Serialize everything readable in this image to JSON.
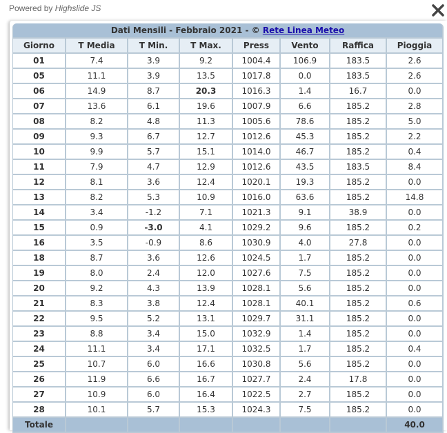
{
  "powered": {
    "prefix": "Powered by",
    "brand": "Highslide JS"
  },
  "close_icon": "close-x-icon",
  "title": {
    "text": "Dati Mensili - Febbraio 2021 - © ",
    "link": "Rete Linea Meteo"
  },
  "columns": [
    "Giorno",
    "T Media",
    "T Min.",
    "T Max.",
    "Press",
    "Vento",
    "Raffica",
    "Pioggia"
  ],
  "colors": {
    "header_bg": "#a9c0d6",
    "day_link": "#1f6aa0",
    "tmax_highlight": "#b40000",
    "tmin_highlight": "#0000aa"
  },
  "rows": [
    [
      "01",
      "7.4",
      "3.9",
      "9.2",
      "1004.4",
      "106.9",
      "183.5",
      "2.6"
    ],
    [
      "05",
      "11.1",
      "3.9",
      "13.5",
      "1017.8",
      "0.0",
      "183.5",
      "2.6"
    ],
    [
      "06",
      "14.9",
      "8.7",
      "20.3",
      "1016.3",
      "1.4",
      "16.7",
      "0.0"
    ],
    [
      "07",
      "13.6",
      "6.1",
      "19.6",
      "1007.9",
      "6.6",
      "185.2",
      "2.8"
    ],
    [
      "08",
      "8.2",
      "4.8",
      "11.3",
      "1005.6",
      "78.6",
      "185.2",
      "5.0"
    ],
    [
      "09",
      "9.3",
      "6.7",
      "12.7",
      "1012.6",
      "45.3",
      "185.2",
      "2.2"
    ],
    [
      "10",
      "9.9",
      "5.7",
      "15.1",
      "1014.0",
      "46.7",
      "185.2",
      "0.4"
    ],
    [
      "11",
      "7.9",
      "4.7",
      "12.9",
      "1012.6",
      "43.5",
      "183.5",
      "8.4"
    ],
    [
      "12",
      "8.1",
      "3.6",
      "12.4",
      "1020.1",
      "19.3",
      "185.2",
      "0.0"
    ],
    [
      "13",
      "8.2",
      "5.3",
      "10.9",
      "1016.0",
      "63.6",
      "185.2",
      "14.8"
    ],
    [
      "14",
      "3.4",
      "-1.2",
      "7.1",
      "1021.3",
      "9.1",
      "38.9",
      "0.0"
    ],
    [
      "15",
      "0.9",
      "-3.0",
      "4.1",
      "1029.2",
      "9.6",
      "185.2",
      "0.2"
    ],
    [
      "16",
      "3.5",
      "-0.9",
      "8.6",
      "1030.9",
      "4.0",
      "27.8",
      "0.0"
    ],
    [
      "18",
      "8.7",
      "3.6",
      "12.6",
      "1024.5",
      "1.7",
      "185.2",
      "0.0"
    ],
    [
      "19",
      "8.0",
      "2.4",
      "12.0",
      "1027.6",
      "7.5",
      "185.2",
      "0.0"
    ],
    [
      "20",
      "9.2",
      "4.3",
      "13.9",
      "1028.1",
      "5.6",
      "185.2",
      "0.0"
    ],
    [
      "21",
      "8.3",
      "3.8",
      "12.4",
      "1028.1",
      "40.1",
      "185.2",
      "0.6"
    ],
    [
      "22",
      "9.5",
      "5.2",
      "13.1",
      "1029.7",
      "31.1",
      "185.2",
      "0.0"
    ],
    [
      "23",
      "8.8",
      "3.4",
      "15.0",
      "1032.9",
      "1.4",
      "185.2",
      "0.0"
    ],
    [
      "24",
      "11.1",
      "3.4",
      "17.1",
      "1032.5",
      "1.7",
      "185.2",
      "0.4"
    ],
    [
      "25",
      "10.7",
      "6.0",
      "16.6",
      "1030.8",
      "5.6",
      "185.2",
      "0.0"
    ],
    [
      "26",
      "11.9",
      "6.6",
      "16.7",
      "1027.7",
      "2.4",
      "17.8",
      "0.0"
    ],
    [
      "27",
      "10.9",
      "6.0",
      "16.4",
      "1022.5",
      "2.7",
      "185.2",
      "0.0"
    ],
    [
      "28",
      "10.1",
      "5.7",
      "15.3",
      "1024.3",
      "7.5",
      "185.2",
      "0.0"
    ]
  ],
  "highlights": {
    "tmax_row": 2,
    "tmin_row": 11
  },
  "totals": {
    "label": "Totale",
    "pioggia": "40.0"
  }
}
